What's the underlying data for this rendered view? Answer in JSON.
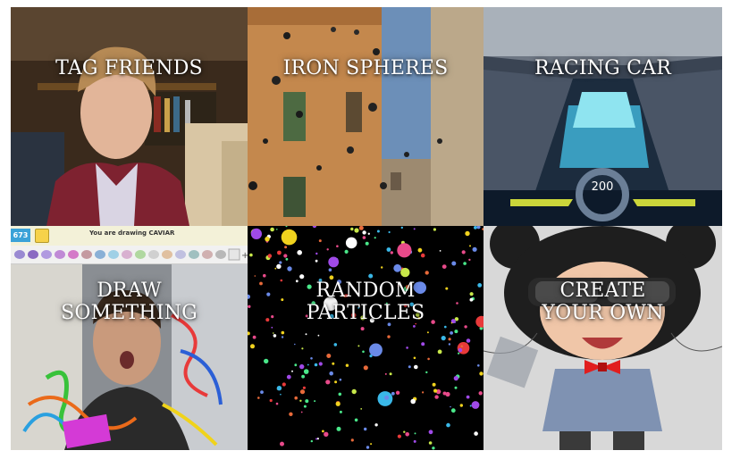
{
  "tiles": [
    {
      "id": "tag-friends",
      "lines": [
        "TAG FRIENDS"
      ]
    },
    {
      "id": "iron-spheres",
      "lines": [
        "IRON SPHERES"
      ]
    },
    {
      "id": "racing-car",
      "lines": [
        "RACING CAR"
      ],
      "speed": "200"
    },
    {
      "id": "draw-something",
      "lines": [
        "DRAW",
        "SOMETHING"
      ],
      "score": "673",
      "prompt": "You are drawing CAVIAR"
    },
    {
      "id": "random-particles",
      "lines": [
        "RANDOM",
        "PARTICLES"
      ]
    },
    {
      "id": "create-your-own",
      "lines": [
        "CREATE",
        "YOUR OWN"
      ]
    }
  ]
}
